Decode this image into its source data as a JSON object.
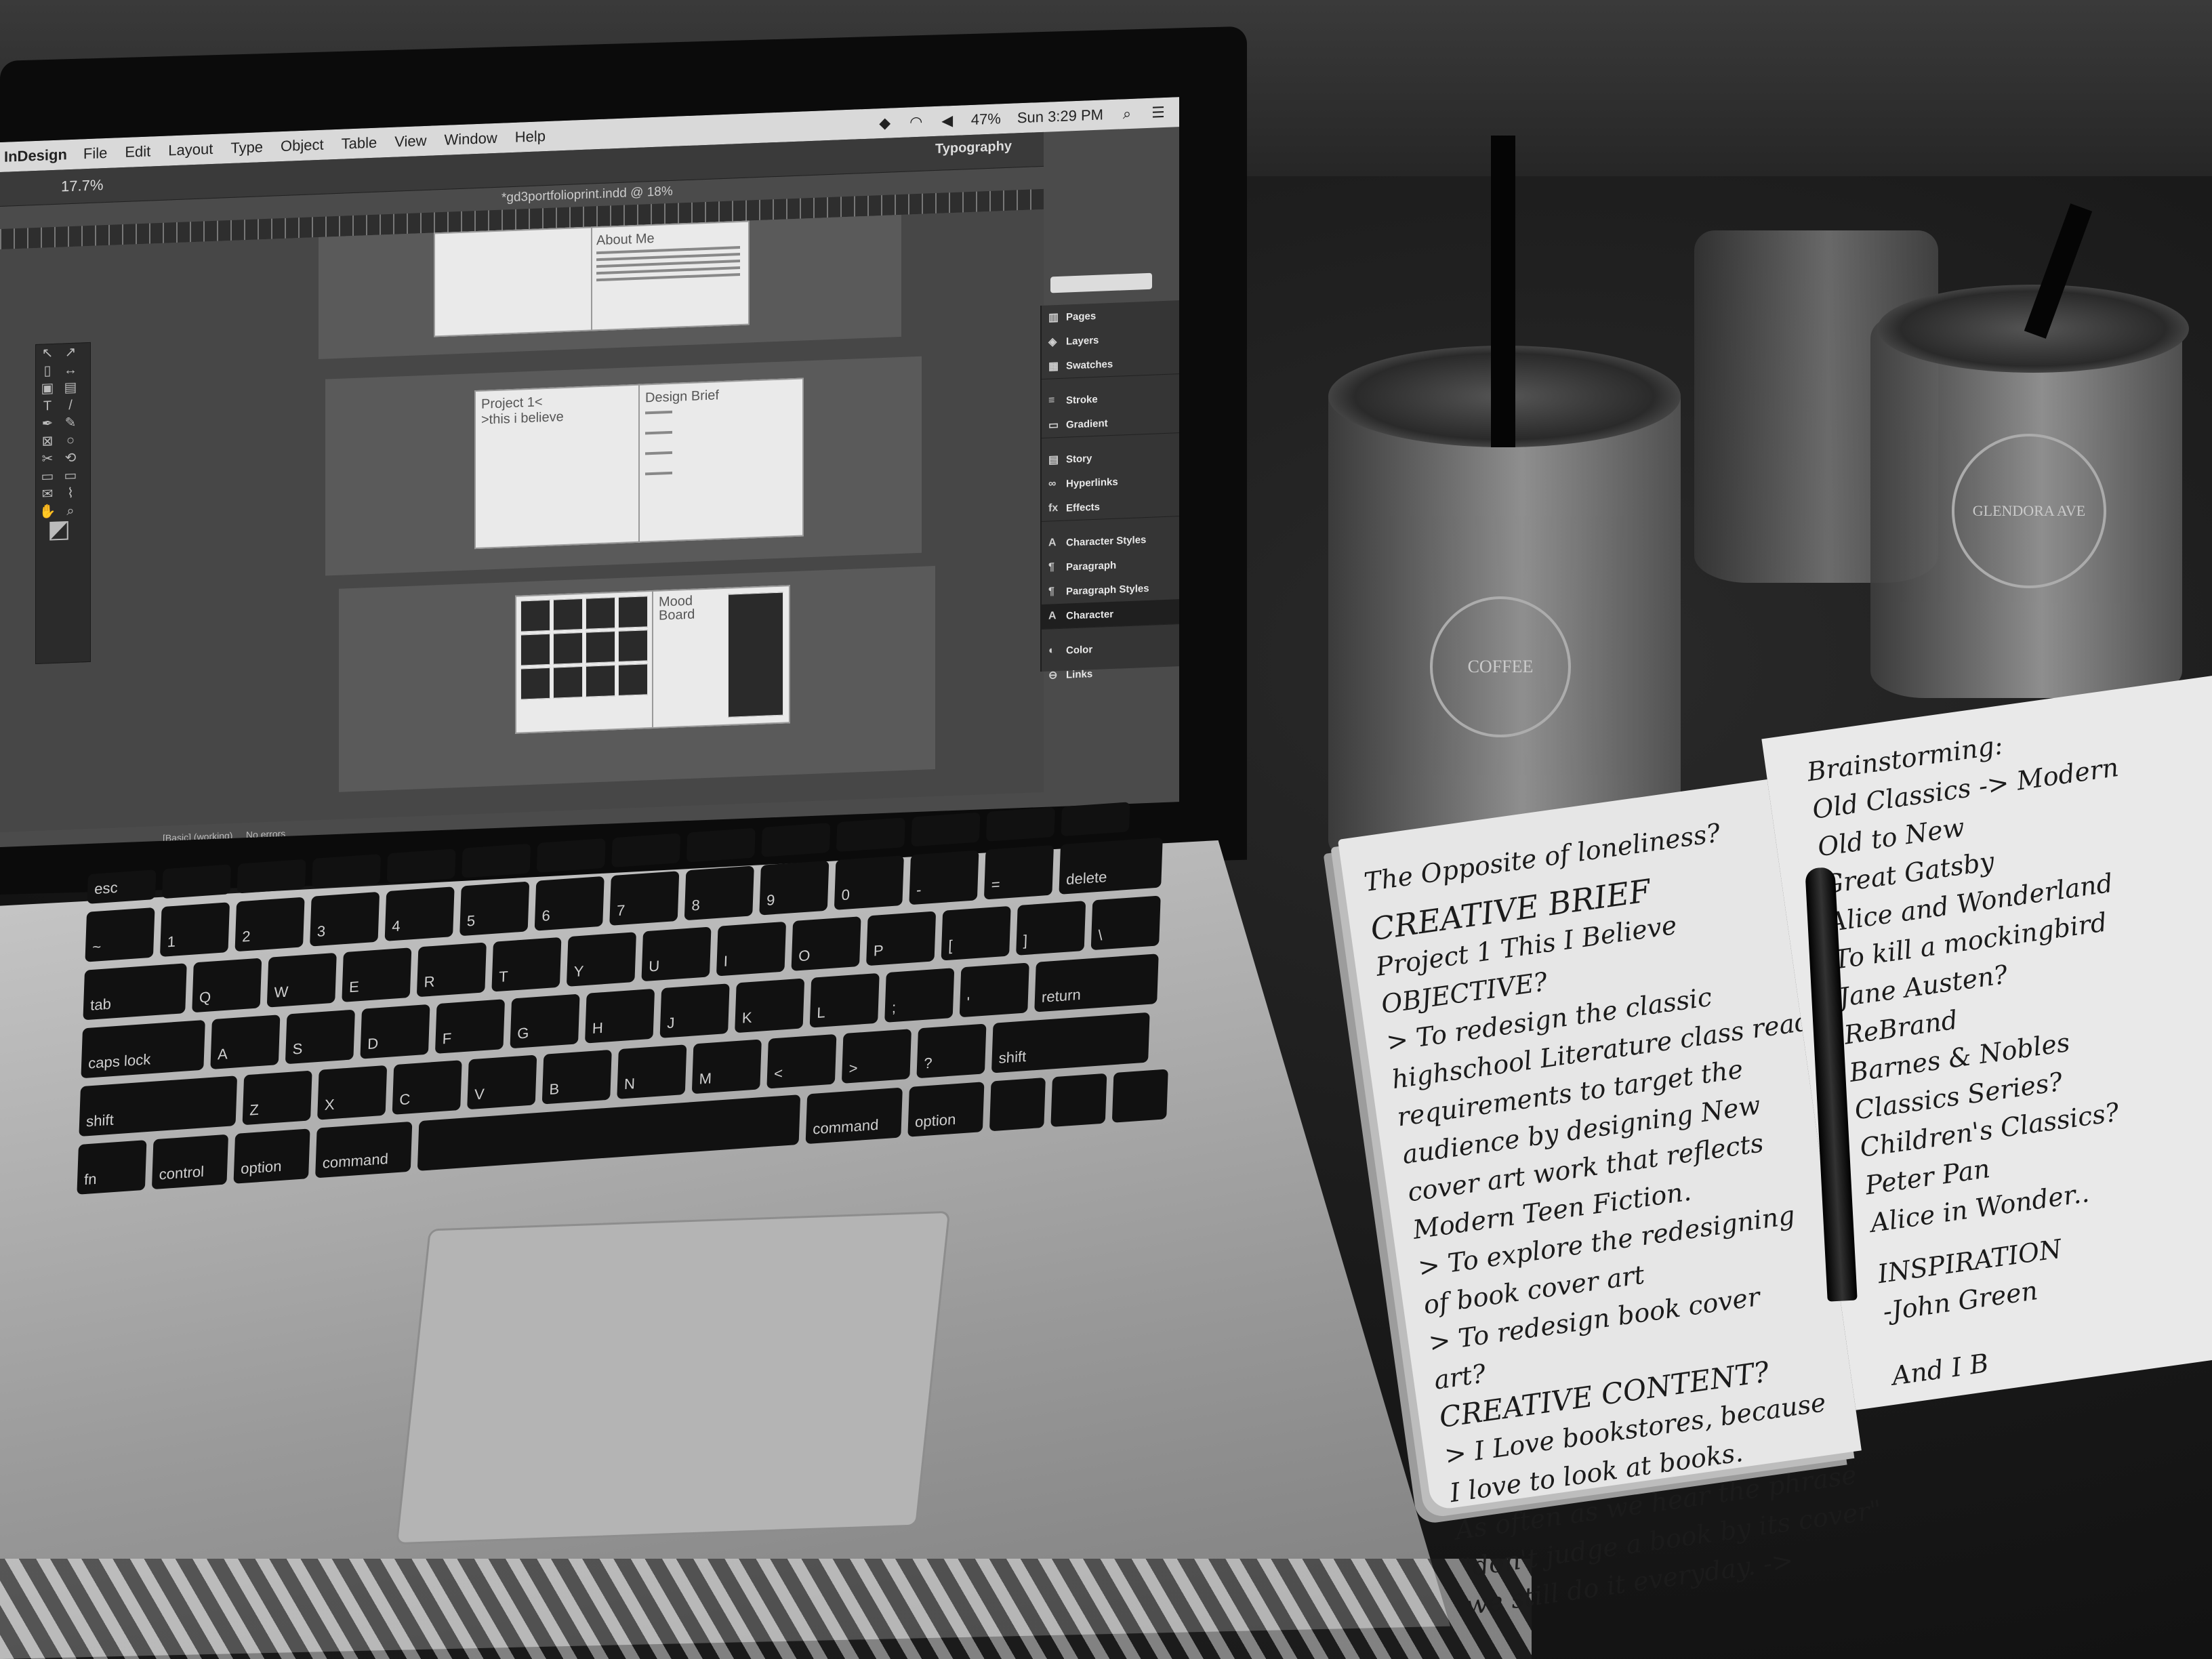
{
  "app": {
    "name": "InDesign",
    "menus": [
      "File",
      "Edit",
      "Layout",
      "Type",
      "Object",
      "Table",
      "View",
      "Window",
      "Help"
    ],
    "status": {
      "battery": "47%",
      "clock": "Sun 3:29 PM"
    },
    "workspace": "Typography",
    "zoom": "17.7%",
    "document_tab": "*gd3portfolioprint.indd @ 18%",
    "status_bar": {
      "profile": "[Basic] (working)",
      "preflight": "No errors"
    }
  },
  "spreads": [
    {
      "left_heading": "",
      "right_heading": "About Me"
    },
    {
      "left_heading": "Project 1<",
      "left_sub": ">this i believe",
      "right_heading": "Design Brief"
    },
    {
      "left_heading": "",
      "right_heading": "Mood Board"
    }
  ],
  "panels": [
    {
      "label": "Pages",
      "icon": "pages-icon",
      "glyph": "▥"
    },
    {
      "label": "Layers",
      "icon": "layers-icon",
      "glyph": "◈"
    },
    {
      "label": "Swatches",
      "icon": "swatches-icon",
      "glyph": "▦"
    },
    {
      "label": "Stroke",
      "icon": "stroke-icon",
      "glyph": "≡"
    },
    {
      "label": "Gradient",
      "icon": "gradient-icon",
      "glyph": "▭"
    },
    {
      "label": "Story",
      "icon": "story-icon",
      "glyph": "▤"
    },
    {
      "label": "Hyperlinks",
      "icon": "hyperlinks-icon",
      "glyph": "∞"
    },
    {
      "label": "Effects",
      "icon": "effects-icon",
      "glyph": "fx"
    },
    {
      "label": "Character Styles",
      "icon": "character-styles-icon",
      "glyph": "A"
    },
    {
      "label": "Paragraph",
      "icon": "paragraph-icon",
      "glyph": "¶"
    },
    {
      "label": "Paragraph Styles",
      "icon": "paragraph-styles-icon",
      "glyph": "¶"
    },
    {
      "label": "Character",
      "icon": "character-icon",
      "glyph": "A"
    },
    {
      "label": "Color",
      "icon": "color-icon",
      "glyph": "◐"
    },
    {
      "label": "Links",
      "icon": "links-icon",
      "glyph": "⊖"
    }
  ],
  "keyboard": {
    "rows": [
      [
        "esc",
        "",
        "",
        "",
        "",
        "",
        "",
        "",
        "",
        "",
        "",
        "",
        "",
        "",
        ""
      ],
      [
        "~",
        "1",
        "2",
        "3",
        "4",
        "5",
        "6",
        "7",
        "8",
        "9",
        "0",
        "-",
        "=",
        "delete"
      ],
      [
        "tab",
        "Q",
        "W",
        "E",
        "R",
        "T",
        "Y",
        "U",
        "I",
        "O",
        "P",
        "[",
        "]",
        "\\"
      ],
      [
        "caps lock",
        "A",
        "S",
        "D",
        "F",
        "G",
        "H",
        "J",
        "K",
        "L",
        ";",
        "'",
        "return"
      ],
      [
        "shift",
        "Z",
        "X",
        "C",
        "V",
        "B",
        "N",
        "M",
        "<",
        ">",
        "?",
        "shift"
      ],
      [
        "fn",
        "control",
        "option",
        "command",
        "",
        "command",
        "option"
      ]
    ]
  },
  "notebook": {
    "left_page": [
      "The Opposite of loneliness?",
      "CREATIVE BRIEF",
      "Project 1  This I Believe",
      "OBJECTIVE?",
      "> To redesign the classic",
      "highschool Literature class reading",
      "requirements to target the",
      "audience by designing New",
      "cover art work that reflects",
      "Modern Teen Fiction.",
      "> To explore the redesigning",
      "of book cover art",
      "> To redesign book cover",
      "art?",
      "CREATIVE CONTENT?",
      "> I Love bookstores, because",
      "I love to look at books.",
      "As often as we hear the phrase",
      "\"don't judge a book by its cover\"",
      "we still do it everyday. ->"
    ],
    "right_page": [
      "Brainstorming:",
      "Old Classics -> Modern",
      "Old to New",
      "Great Gatsby",
      "Alice and Wonderland",
      "To kill a mockingbird",
      "Jane Austen?",
      "ReBrand",
      "Barnes & Nobles",
      "Classics Series?",
      "Children's Classics?",
      "Peter Pan",
      "Alice in Wonder..",
      "INSPIRATION",
      "-John Green",
      "And I B"
    ]
  },
  "cups": [
    {
      "logo": "COFFEE"
    },
    {
      "logo": "GLENDORA AVE"
    }
  ]
}
